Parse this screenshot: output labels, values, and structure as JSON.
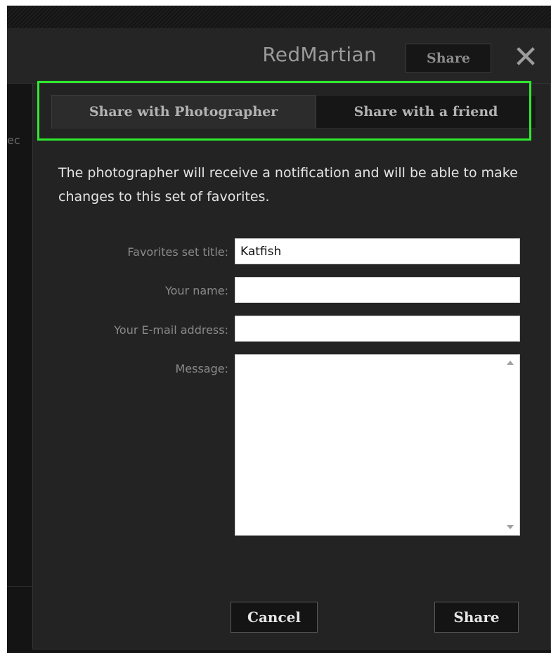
{
  "header": {
    "title": "RedMartian",
    "share_label": "Share",
    "close_glyph": "✕"
  },
  "background": {
    "left_edge_text": "ec"
  },
  "dialog": {
    "tabs": [
      {
        "label": "Share with Photographer",
        "active": true
      },
      {
        "label": "Share with a friend",
        "active": false
      }
    ],
    "intro": "The photographer will receive a notification and will be able to make changes to this set of favorites.",
    "fields": {
      "title": {
        "label": "Favorites set title:",
        "value": "Katfish"
      },
      "name": {
        "label": "Your name:",
        "value": ""
      },
      "email": {
        "label": "Your E-mail address:",
        "value": ""
      },
      "message": {
        "label": "Message:",
        "value": ""
      }
    },
    "cancel_label": "Cancel",
    "share_label": "Share"
  },
  "colors": {
    "highlight": "#2eea2e",
    "background": "#141414",
    "dialog": "#232323"
  },
  "icons": {
    "close": "close-icon",
    "scroll_up": "arrow-up-icon",
    "scroll_down": "arrow-down-icon"
  }
}
